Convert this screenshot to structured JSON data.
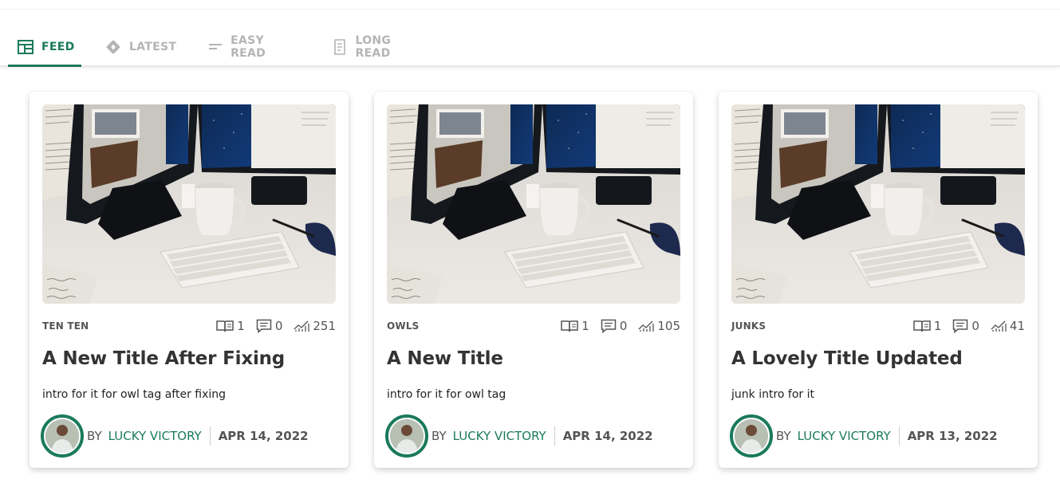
{
  "tabs": [
    {
      "label": "FEED",
      "icon": "feed-icon",
      "active": true
    },
    {
      "label": "LATEST",
      "icon": "diamond-icon",
      "active": false
    },
    {
      "label": "EASY READ",
      "icon": "short-lines-icon",
      "active": false
    },
    {
      "label": "LONG READ",
      "icon": "document-icon",
      "active": false
    }
  ],
  "colors": {
    "accent": "#1b7a5c",
    "inactive": "#b4b4b4",
    "text": "#333333"
  },
  "posts": [
    {
      "tag": "TEN TEN",
      "reads": "1",
      "comments": "0",
      "views": "251",
      "title": "A New Title After Fixing",
      "intro": "intro for it for owl tag after fixing",
      "by": "BY",
      "author": "LUCKY VICTORY",
      "date": "APR 14, 2022"
    },
    {
      "tag": "OWLS",
      "reads": "1",
      "comments": "0",
      "views": "105",
      "title": "A New Title",
      "intro": "intro for it for owl tag",
      "by": "BY",
      "author": "LUCKY VICTORY",
      "date": "APR 14, 2022"
    },
    {
      "tag": "JUNKS",
      "reads": "1",
      "comments": "0",
      "views": "41",
      "title": "A Lovely Title Updated",
      "intro": "junk intro for it",
      "by": "BY",
      "author": "LUCKY VICTORY",
      "date": "APR 13, 2022"
    }
  ]
}
